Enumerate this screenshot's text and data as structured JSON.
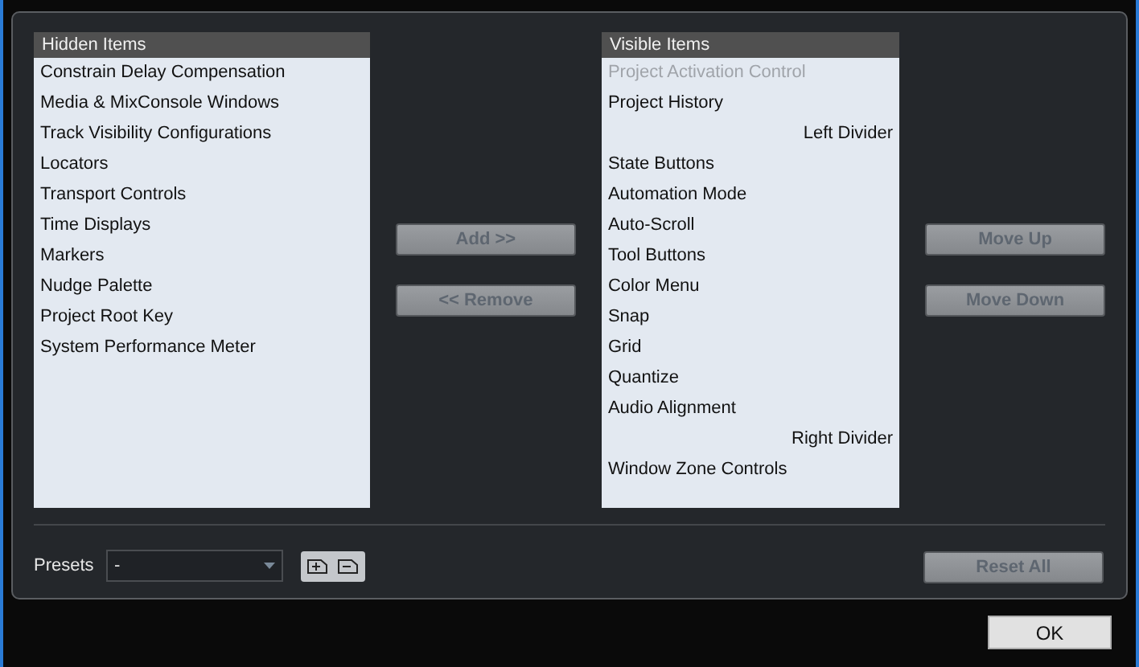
{
  "hidden_list": {
    "header": "Hidden Items",
    "items": [
      {
        "label": "Constrain Delay Compensation",
        "disabled": false
      },
      {
        "label": "Media & MixConsole Windows",
        "disabled": false
      },
      {
        "label": "Track Visibility Configurations",
        "disabled": false
      },
      {
        "label": "Locators",
        "disabled": false
      },
      {
        "label": "Transport Controls",
        "disabled": false
      },
      {
        "label": "Time Displays",
        "disabled": false
      },
      {
        "label": "Markers",
        "disabled": false
      },
      {
        "label": "Nudge Palette",
        "disabled": false
      },
      {
        "label": "Project Root Key",
        "disabled": false
      },
      {
        "label": "System Performance Meter",
        "disabled": false
      }
    ]
  },
  "transfer_buttons": [
    {
      "label": "Add >>",
      "disabled": true
    },
    {
      "label": "<< Remove",
      "disabled": true
    }
  ],
  "visible_list": {
    "header": "Visible Items",
    "items": [
      {
        "label": "Project Activation Control",
        "kind": "item",
        "disabled": true
      },
      {
        "label": "Project History",
        "kind": "item",
        "disabled": false
      },
      {
        "label": "Left Divider",
        "kind": "divider",
        "disabled": false
      },
      {
        "label": "State Buttons",
        "kind": "item",
        "disabled": false
      },
      {
        "label": "Automation Mode",
        "kind": "item",
        "disabled": false
      },
      {
        "label": "Auto-Scroll",
        "kind": "item",
        "disabled": false
      },
      {
        "label": "Tool Buttons",
        "kind": "item",
        "disabled": false
      },
      {
        "label": "Color Menu",
        "kind": "item",
        "disabled": false
      },
      {
        "label": "Snap",
        "kind": "item",
        "disabled": false
      },
      {
        "label": "Grid",
        "kind": "item",
        "disabled": false
      },
      {
        "label": "Quantize",
        "kind": "item",
        "disabled": false
      },
      {
        "label": "Audio Alignment",
        "kind": "item",
        "disabled": false
      },
      {
        "label": "Right Divider",
        "kind": "divider",
        "disabled": false
      },
      {
        "label": "Window Zone Controls",
        "kind": "item",
        "disabled": false
      }
    ]
  },
  "move_buttons": [
    {
      "label": "Move Up",
      "disabled": true
    },
    {
      "label": "Move Down",
      "disabled": true
    }
  ],
  "presets": {
    "label": "Presets",
    "value": "-"
  },
  "reset_button": {
    "label": "Reset All",
    "disabled": true
  },
  "ok_button": {
    "label": "OK"
  }
}
